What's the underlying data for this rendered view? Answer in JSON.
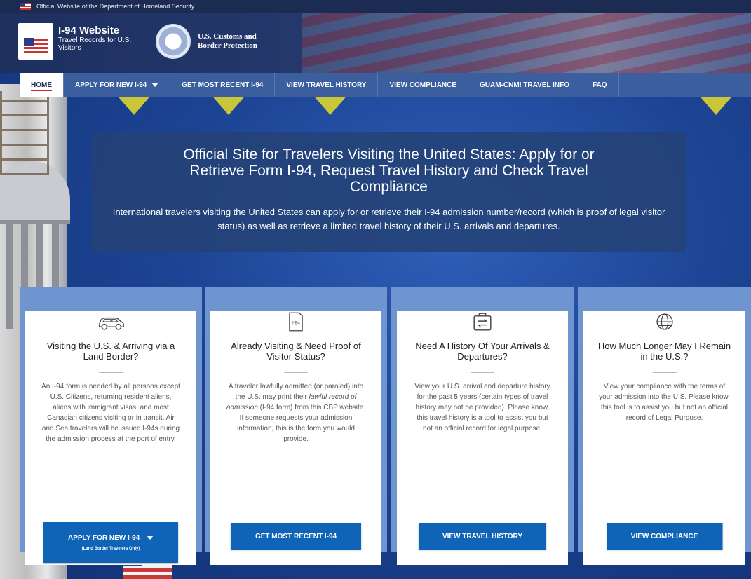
{
  "gov_banner": {
    "text": "Official Website of the Department of Homeland Security"
  },
  "header": {
    "site_title": "I-94 Website",
    "site_subtitle": "Travel Records for U.S. Visitors",
    "agency_name_line1": "U.S. Customs and",
    "agency_name_line2": "Border Protection"
  },
  "nav": {
    "items": [
      {
        "label": "HOME",
        "active": true
      },
      {
        "label": "APPLY FOR NEW I-94",
        "has_dropdown": true
      },
      {
        "label": "GET MOST RECENT I-94"
      },
      {
        "label": "VIEW TRAVEL HISTORY"
      },
      {
        "label": "VIEW COMPLIANCE"
      },
      {
        "label": "GUAM-CNMI TRAVEL INFO"
      },
      {
        "label": "FAQ"
      }
    ]
  },
  "hero": {
    "title": "Official Site for Travelers Visiting the United States: Apply for or Retrieve Form I-94, Request Travel History and Check Travel Compliance",
    "description": "International travelers visiting the United States can apply for or retrieve their I-94 admission number/record (which is proof of legal visitor status) as well as retrieve a limited travel history of their U.S. arrivals and departures."
  },
  "cards": [
    {
      "icon": "car-icon",
      "title": "Visiting the U.S. & Arriving via a Land Border?",
      "body": "An I-94 form is needed by all persons except U.S. Citizens, returning resident aliens, aliens with immigrant visas, and most Canadian citizens visiting or in transit. Air and Sea travelers will be issued I-94s during the admission process at the port of entry.",
      "button_label": "APPLY FOR NEW I-94",
      "button_sublabel": "(Land Border Travelers Only)"
    },
    {
      "icon": "i94-document-icon",
      "icon_text": "I-94",
      "title": "Already Visiting & Need Proof of Visitor Status?",
      "body_prefix": "A traveler lawfully admitted (or paroled) into the U.S. may print their ",
      "body_emphasis": "lawful record of admission",
      "body_suffix": " (I-94 form) from this CBP website. If someone requests your admission information, this is the form you would provide.",
      "button_label": "GET MOST RECENT I-94"
    },
    {
      "icon": "travel-history-icon",
      "title": "Need A History Of Your Arrivals & Departures?",
      "body": "View your U.S. arrival and departure history for the past 5 years (certain types of travel history may not be provided). Please know, this travel history is a tool to assist you but not an official record for legal purpose.",
      "button_label": "VIEW TRAVEL HISTORY"
    },
    {
      "icon": "globe-icon",
      "title": "How Much Longer May I Remain in the U.S.?",
      "body": "View your compliance with the terms of your admission into the U.S. Please know, this tool is to assist you but not an official record of Legal Purpose.",
      "button_label": "VIEW COMPLIANCE"
    }
  ],
  "colors": {
    "nav_bg": "#3a5e9e",
    "button_bg": "#0f64b8",
    "card_frame": "#6f95d0",
    "active_underline": "#d2202f"
  }
}
